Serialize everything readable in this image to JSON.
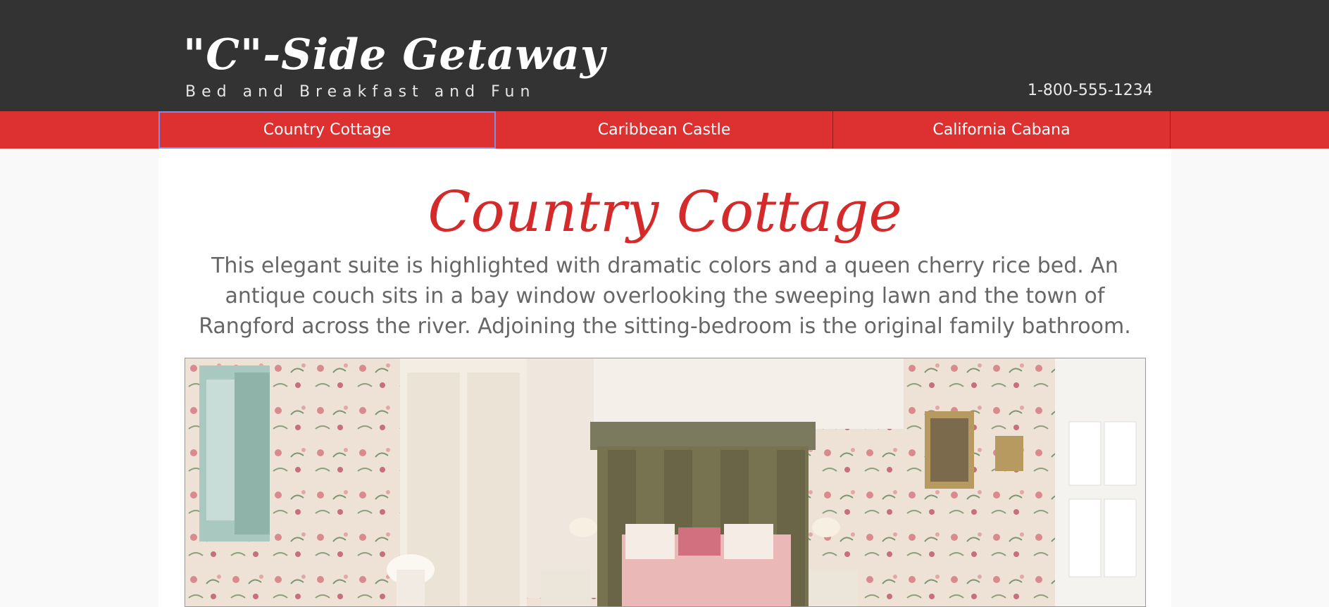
{
  "header": {
    "logo_title": "\"C\"-Side Getaway",
    "tagline": "Bed and Breakfast and Fun",
    "phone": "1-800-555-1234"
  },
  "nav": {
    "items": [
      {
        "label": "Country Cottage",
        "active": true
      },
      {
        "label": "Caribbean Castle",
        "active": false
      },
      {
        "label": "California Cabana",
        "active": false
      }
    ]
  },
  "main": {
    "title": "Country Cottage",
    "description": "This elegant suite is highlighted with dramatic colors and a queen cherry rice bed. An antique couch sits in a bay window overlooking the sweeping lawn and the town of Rangford across the river. Adjoining the sitting-bedroom is the original family bathroom."
  },
  "colors": {
    "header_bg": "#333333",
    "nav_bg": "#dd3131",
    "accent": "#d42a2a",
    "body_text": "#666666"
  }
}
